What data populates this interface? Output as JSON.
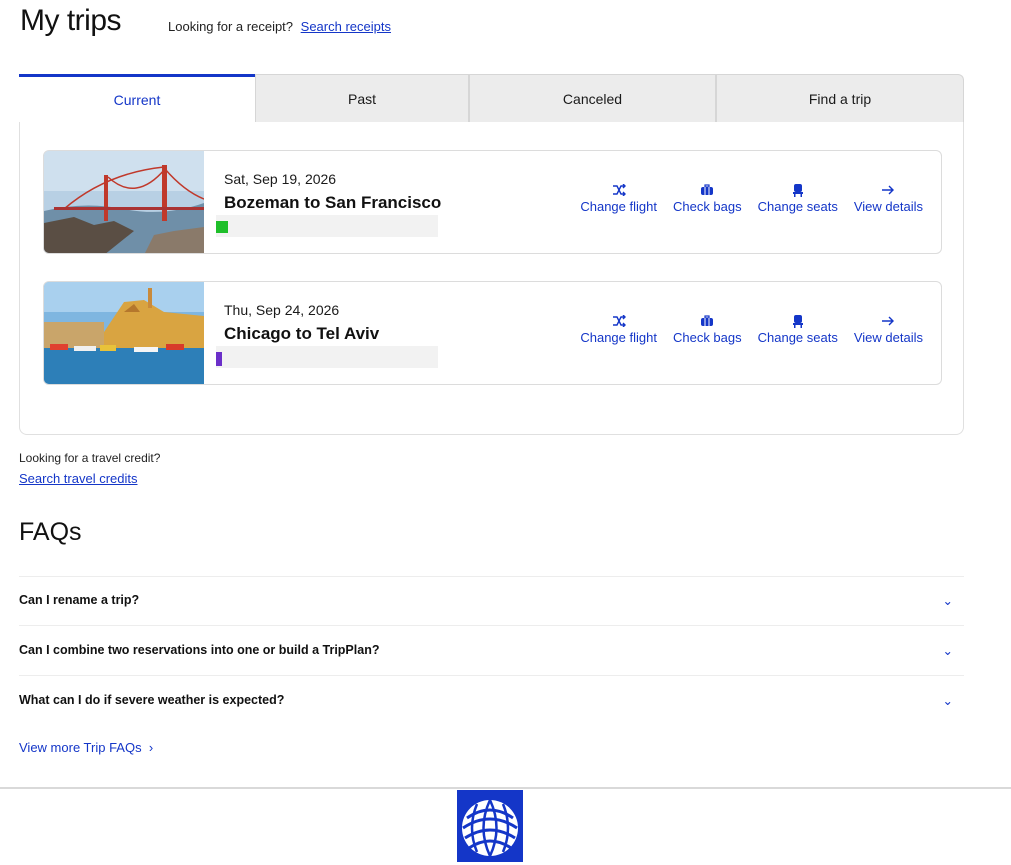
{
  "header": {
    "title": "My trips",
    "receipt_prompt": "Looking for a receipt?",
    "receipt_link": "Search receipts"
  },
  "tabs": [
    {
      "label": "Current",
      "active": true
    },
    {
      "label": "Past",
      "active": false
    },
    {
      "label": "Canceled",
      "active": false
    },
    {
      "label": "Find a trip",
      "active": false
    }
  ],
  "trips": [
    {
      "date": "Sat, Sep 19, 2026",
      "route": "Bozeman to San Francisco",
      "image": "golden-gate-bridge"
    },
    {
      "date": "Thu, Sep 24, 2026",
      "route": "Chicago to Tel Aviv",
      "image": "jaffa-harbor"
    }
  ],
  "actions": {
    "change_flight": "Change flight",
    "check_bags": "Check bags",
    "change_seats": "Change seats",
    "view_details": "View details"
  },
  "credit": {
    "prompt": "Looking for a travel credit?",
    "link": "Search travel credits"
  },
  "faqs": {
    "title": "FAQs",
    "items": [
      "Can I rename a trip?",
      "Can I combine two reservations into one or build a TripPlan?",
      "What can I do if severe weather is expected?"
    ],
    "more": "View more Trip FAQs"
  },
  "icons": {
    "change_flight": "shuffle-icon",
    "check_bags": "suitcase-icon",
    "change_seats": "seat-icon",
    "view_details": "arrow-right-icon",
    "faq_toggle": "chevron-down-icon"
  },
  "colors": {
    "accent": "#1436c8",
    "tab_inactive": "#ececec",
    "logo_blue": "#1436c8"
  }
}
